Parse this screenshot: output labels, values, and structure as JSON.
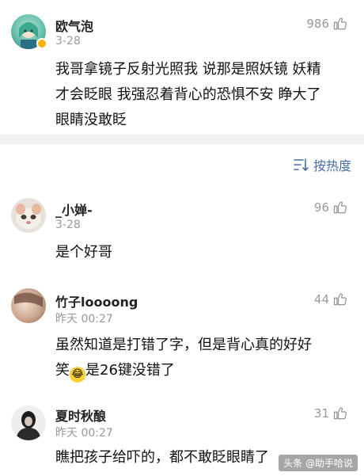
{
  "top_comment": {
    "name": "欧气泡",
    "date": "3-28",
    "likes": "986",
    "line1": "我哥拿镜子反射光照我 说那是照妖镜 妖精",
    "line2": "才会眨眼 我强忍着背心的恐惧不安 睁大了",
    "line3": "眼睛没敢眨"
  },
  "sort": {
    "label": "按热度"
  },
  "comments": [
    {
      "name": "_小婵-",
      "date": "3-28",
      "likes": "96",
      "line1": "是个好哥"
    },
    {
      "name": "竹子loooong",
      "date": "昨天 00:27",
      "likes": "44",
      "line1": "虽然知道是打错了字，但是背心真的好好",
      "line2a": "笑",
      "line2b": "是26键没错了"
    },
    {
      "name": "夏时秋酿",
      "date": "昨天 00:27",
      "likes": "31",
      "line1": "瞧把孩子给吓的，都不敢眨眼睛了"
    }
  ],
  "watermark": "头条 @助手哈说",
  "colors": {
    "accent": "#4a6ea9",
    "muted": "#9a9a9a",
    "divider": "#f2f2f2"
  },
  "icons": {
    "like": "thumbs-up-icon",
    "sort": "sort-icon",
    "verified": "verified-badge-icon",
    "laugh": "laughing-emoji-icon"
  }
}
